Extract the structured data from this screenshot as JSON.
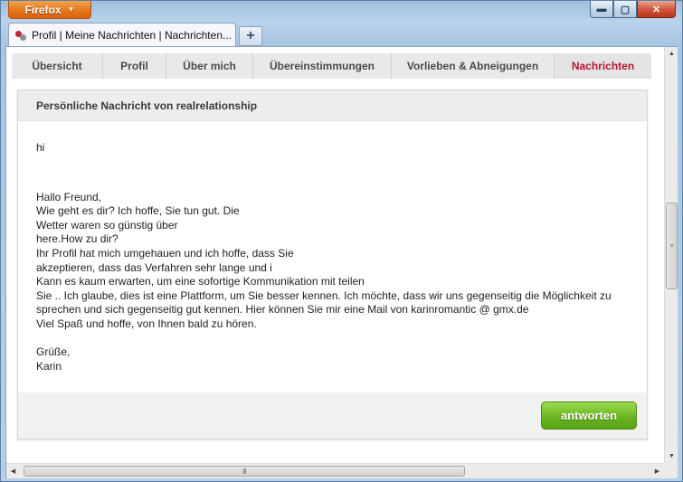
{
  "browser": {
    "menu_label": "Firefox",
    "tab_title": "Profil | Meine Nachrichten | Nachrichten...",
    "new_tab_label": "+",
    "window_controls": {
      "minimize": "▬",
      "maximize": "▢",
      "close": "✕"
    }
  },
  "site_tabs": [
    {
      "label": "Übersicht",
      "active": false
    },
    {
      "label": "Profil",
      "active": false
    },
    {
      "label": "Über mich",
      "active": false
    },
    {
      "label": "Übereinstimmungen",
      "active": false
    },
    {
      "label": "Vorlieben & Abneigungen",
      "active": false
    },
    {
      "label": "Nachrichten",
      "active": true
    }
  ],
  "message": {
    "header": "Persönliche Nachricht von realrelationship",
    "greeting": "hi",
    "lines": [
      "Hallo Freund,",
      "Wie geht es dir? Ich hoffe, Sie tun gut. Die",
      "Wetter waren so günstig über",
      "here.How zu dir?",
      "Ihr Profil hat mich umgehauen und ich hoffe, dass Sie",
      "akzeptieren, dass das Verfahren sehr lange und i",
      "Kann es kaum erwarten, um eine sofortige Kommunikation mit teilen",
      "Sie .. Ich glaube, dies ist eine Plattform, um Sie besser kennen. Ich möchte, dass wir uns gegenseitig die Möglichkeit zu",
      "sprechen und sich gegenseitig gut kennen. Hier können Sie mir eine Mail von karinromantic @ gmx.de",
      "Viel Spaß und hoffe, von Ihnen bald zu hören."
    ],
    "closing": [
      "Grüße,",
      "Karin"
    ]
  },
  "reply_button_label": "antworten",
  "scrollbar": {
    "grip": "≡",
    "hgrip": "III",
    "up": "▲",
    "down": "▼",
    "left": "◀",
    "right": "▶"
  }
}
